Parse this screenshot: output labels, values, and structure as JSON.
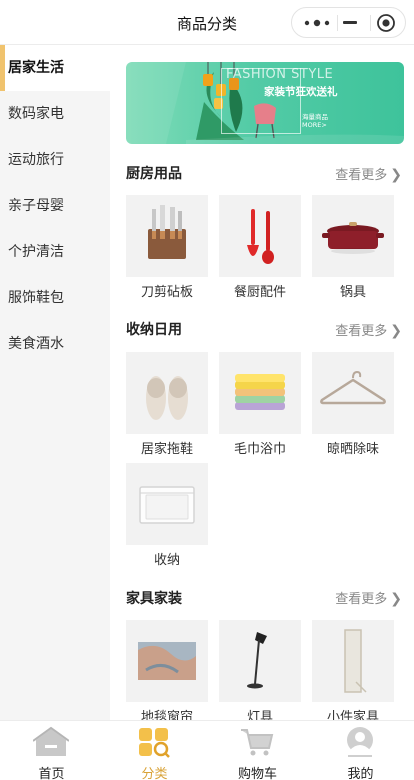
{
  "header": {
    "title": "商品分类"
  },
  "sidebar": {
    "items": [
      {
        "label": "居家生活",
        "active": true
      },
      {
        "label": "数码家电"
      },
      {
        "label": "运动旅行"
      },
      {
        "label": "亲子母婴"
      },
      {
        "label": "个护清洁"
      },
      {
        "label": "服饰鞋包"
      },
      {
        "label": "美食酒水"
      }
    ]
  },
  "banner": {
    "headline": "FASHION STYLE",
    "main": "家装节狂欢送礼",
    "sub": "海量商品",
    "more": "MORE>"
  },
  "sections": [
    {
      "title": "厨房用品",
      "more": "查看更多",
      "items": [
        {
          "label": "刀剪砧板"
        },
        {
          "label": "餐厨配件"
        },
        {
          "label": "锅具"
        }
      ]
    },
    {
      "title": "收纳日用",
      "more": "查看更多",
      "items": [
        {
          "label": "居家拖鞋"
        },
        {
          "label": "毛巾浴巾"
        },
        {
          "label": "晾晒除味"
        },
        {
          "label": "收纳"
        }
      ]
    },
    {
      "title": "家具家装",
      "more": "查看更多",
      "items": [
        {
          "label": "地毯窗帘"
        },
        {
          "label": "灯具"
        },
        {
          "label": "小件家具"
        }
      ]
    }
  ],
  "tabbar": {
    "items": [
      {
        "label": "首页",
        "icon": "home-icon"
      },
      {
        "label": "分类",
        "icon": "category-icon",
        "active": true
      },
      {
        "label": "购物车",
        "icon": "cart-icon"
      },
      {
        "label": "我的",
        "icon": "profile-icon"
      }
    ]
  },
  "colors": {
    "accent": "#f0c36e",
    "active_tab": "#d9a338",
    "banner": "#53cba6"
  }
}
